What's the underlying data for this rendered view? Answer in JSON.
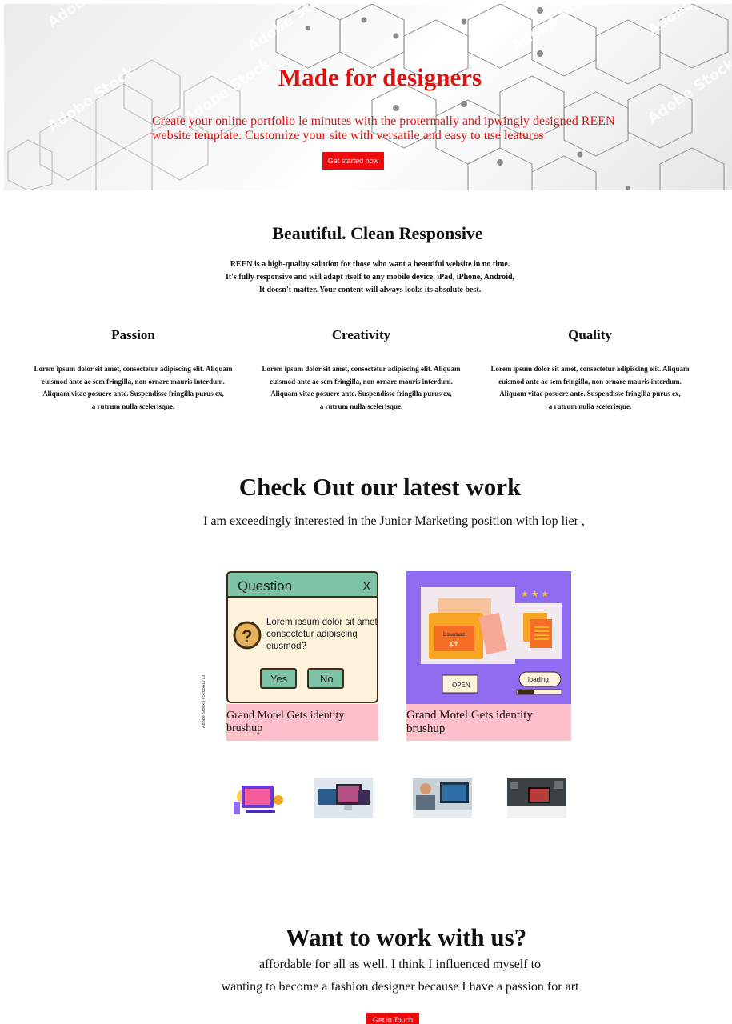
{
  "hero": {
    "title": "Made for designers",
    "text": "Create your online portfolio le minutes with the protermally and ipwingly designed REEN website template. Customize your site with versatile and easy to use leatures",
    "button": "Get started now",
    "watermark": "Adobe Stock"
  },
  "about": {
    "title": "Beautiful. Clean Responsive",
    "lines": [
      "REEN is a high-quality salution for those who want a beautiful website in no time.",
      "It's fully responsive and will adapt itself to any mobile device, iPad, iPhone, Android,",
      "It doesn't matter. Your content will always looks its absolute best."
    ]
  },
  "features": [
    {
      "title": "Passion",
      "lines": [
        "Lorem ipsum dolor sit amet, consectetur adipiscing elit. Aliquam",
        "euismod ante ac sem fringilla, non ornare mauris interdum.",
        "Aliquam vitae posuere ante. Suspendisse fringilla purus ex,",
        "a rutrum nulla scelerisque."
      ]
    },
    {
      "title": "Creativity",
      "lines": [
        "Lorem ipsum dolor sit amet, consectetur adipiscing elit. Aliquam",
        "euismod ante ac sem fringilla, non ornare mauris interdum.",
        "Aliquam vitae posuere ante. Suspendisse fringilla purus ex,",
        "a rutrum nulla scelerisque."
      ]
    },
    {
      "title": "Quality",
      "lines": [
        "Lorem ipsum dolor sit amet, consectetur adipiscing elit. Aliquam",
        "euismod ante ac sem fringilla, non ornare mauris interdum.",
        "Aliquam vitae posuere ante. Suspendisse fringilla purus ex,",
        "a rutrum nulla scelerisque."
      ]
    }
  ],
  "work": {
    "title": "Check Out our latest work",
    "subtitle": "I am exceedingly interested in the Junior Marketing position with lop lier ,",
    "stock_label": "Adobe Stock | #526561773",
    "cards": [
      {
        "caption": "Grand Motel Gets identity brushup",
        "dialog": {
          "title": "Question",
          "close": "X",
          "q1": "Lorem ipsum dolor sit amet,",
          "q2": "consectetur adipiscing",
          "q3": "eiusmod?",
          "mark": "?",
          "yes": "Yes",
          "no": "No"
        }
      },
      {
        "caption": "Grand Motel Gets identity brushup",
        "art": {
          "download": "Download",
          "open": "OPEN",
          "loading": "loading"
        }
      }
    ],
    "thumbnails": [
      "design-illustration",
      "monitors-showcase",
      "person-at-desk",
      "desk-setup"
    ]
  },
  "cta": {
    "title": "Want to work with us?",
    "line1": "affordable for all as well. I think I influenced myself to",
    "line2": "wanting to become a fashion designer because I have a passion for art",
    "button": "Get in Touch"
  },
  "colors": {
    "accent": "#ee0a0a",
    "caption_bg": "#ffc0cb",
    "dialog_header": "#7cc2a4",
    "dialog_body": "#fdf3dc",
    "purple": "#8f6cf0"
  }
}
